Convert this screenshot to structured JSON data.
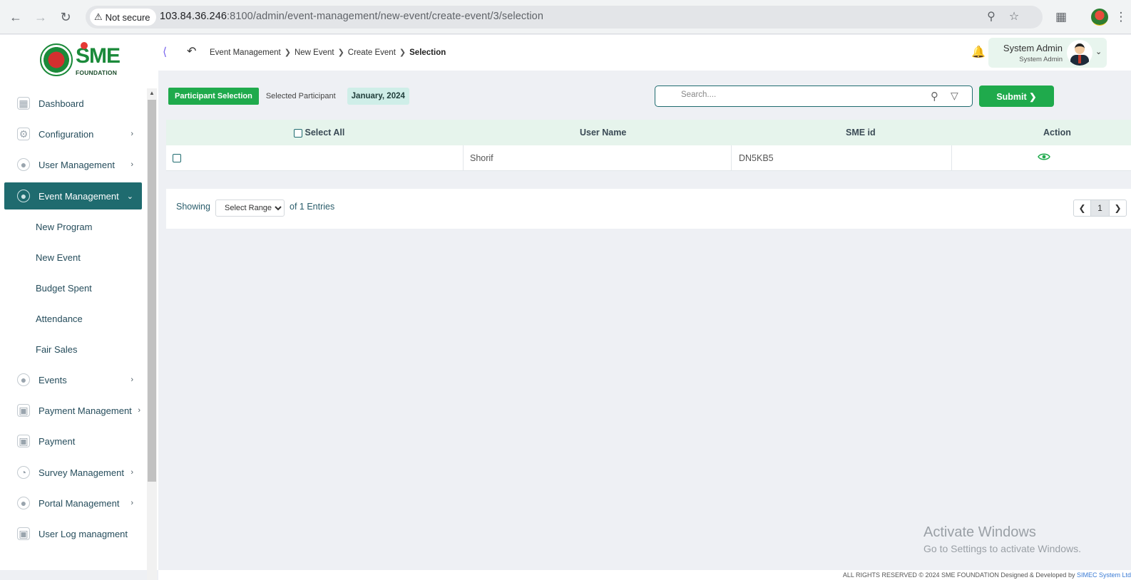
{
  "browser": {
    "security_label": "Not secure",
    "url_host": "103.84.36.246",
    "url_rest": ":8100/admin/event-management/new-event/create-event/3/selection"
  },
  "logo": {
    "brand": "SME",
    "sub": "FOUNDATION"
  },
  "sidebar": {
    "items": [
      {
        "label": "Dashboard",
        "icon": "grid-icon",
        "has_chevron": false
      },
      {
        "label": "Configuration",
        "icon": "settings-icon",
        "has_chevron": true
      },
      {
        "label": "User Management",
        "icon": "shield-user-icon",
        "has_chevron": true
      },
      {
        "label": "Event Management",
        "icon": "lock-icon",
        "has_chevron": true,
        "active": true
      },
      {
        "label": "Events",
        "icon": "lock-icon",
        "has_chevron": true
      },
      {
        "label": "Payment Management",
        "icon": "money-icon",
        "has_chevron": true
      },
      {
        "label": "Payment",
        "icon": "money-icon",
        "has_chevron": false
      },
      {
        "label": "Survey Management",
        "icon": "pie-chart-icon",
        "has_chevron": true
      },
      {
        "label": "Portal Management",
        "icon": "lock-icon",
        "has_chevron": true
      },
      {
        "label": "User Log managment",
        "icon": "money-icon",
        "has_chevron": false
      }
    ],
    "subitems": [
      "New Program",
      "New Event",
      "Budget Spent",
      "Attendance",
      "Fair Sales"
    ]
  },
  "header": {
    "breadcrumbs": [
      "Event Management",
      "New Event",
      "Create Event",
      "Selection"
    ],
    "user_name": "System Admin",
    "user_role": "System Admin"
  },
  "content": {
    "tab_active": "Participant Selection",
    "tab_other": "Selected Participant",
    "date_chip": "January, 2024",
    "search_placeholder": "Search....",
    "submit_label": "Submit",
    "columns": [
      "Select All",
      "User Name",
      "SME id",
      "Action"
    ],
    "rows": [
      {
        "user_name": "Shorif",
        "sme_id": "DN5KB5"
      }
    ],
    "pager": {
      "showing": "Showing",
      "range_placeholder": "Select Range",
      "entries": "of 1 Entries",
      "current_page": "1"
    }
  },
  "watermark": {
    "line1": "Activate Windows",
    "line2": "Go to Settings to activate Windows."
  },
  "footer": {
    "text": "ALL RIGHTS RESERVED © 2024 SME FOUNDATION   Designed & Developed by",
    "brand": "SIMEC System Ltd"
  },
  "colors": {
    "primary_green": "#1faa4c",
    "teal": "#1f6b6f",
    "header_bg": "#e6f4ec"
  }
}
